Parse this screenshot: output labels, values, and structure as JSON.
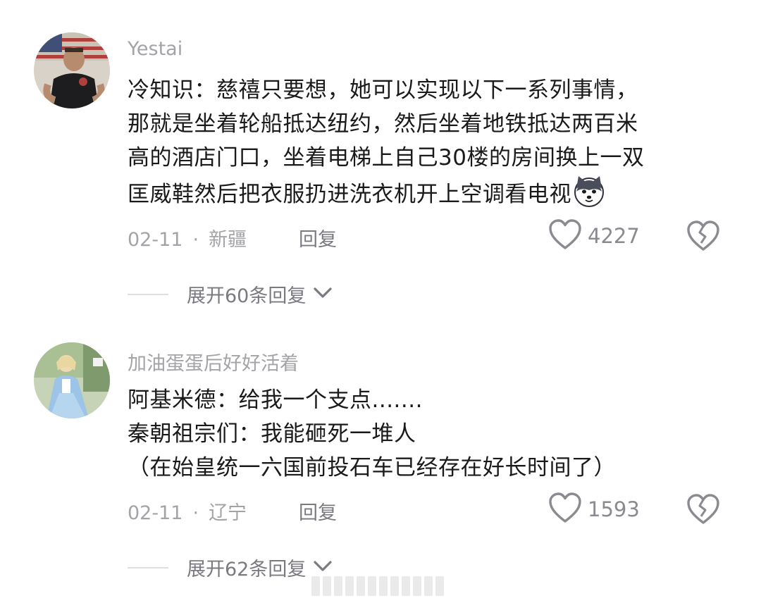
{
  "comments": [
    {
      "username": "Yestai",
      "lines": [
        "冷知识：慈禧只要想，她可以实现以下一系列事情，",
        "那就是坐着轮船抵达纽约，然后坐着地铁抵达两百米",
        "高的酒店门口，坐着电梯上自己30楼的房间换上一双",
        "匡威鞋然后把衣服扔进洗衣机开上空调看电视"
      ],
      "emoji": "husky-dog-emoji",
      "date": "02-11",
      "separator": "·",
      "location": "新疆",
      "reply_label": "回复",
      "likes": "4227",
      "expand_label": "展开60条回复"
    },
    {
      "username": "加油蛋蛋后好好活着",
      "lines": [
        "阿基米德：给我一个支点.......",
        "秦朝祖宗们：我能砸死一堆人",
        "（在始皇统一六国前投石车已经存在好长时间了）"
      ],
      "date": "02-11",
      "separator": "·",
      "location": "辽宁",
      "reply_label": "回复",
      "likes": "1593",
      "expand_label": "展开62条回复"
    }
  ],
  "icons": {
    "like": "heart-outline-icon",
    "dislike": "broken-heart-icon",
    "expand": "chevron-down-icon"
  },
  "colors": {
    "username": "#a3a3a8",
    "body": "#1a1a1a",
    "meta": "#a3a3a8",
    "icon": "#8a8a90"
  }
}
